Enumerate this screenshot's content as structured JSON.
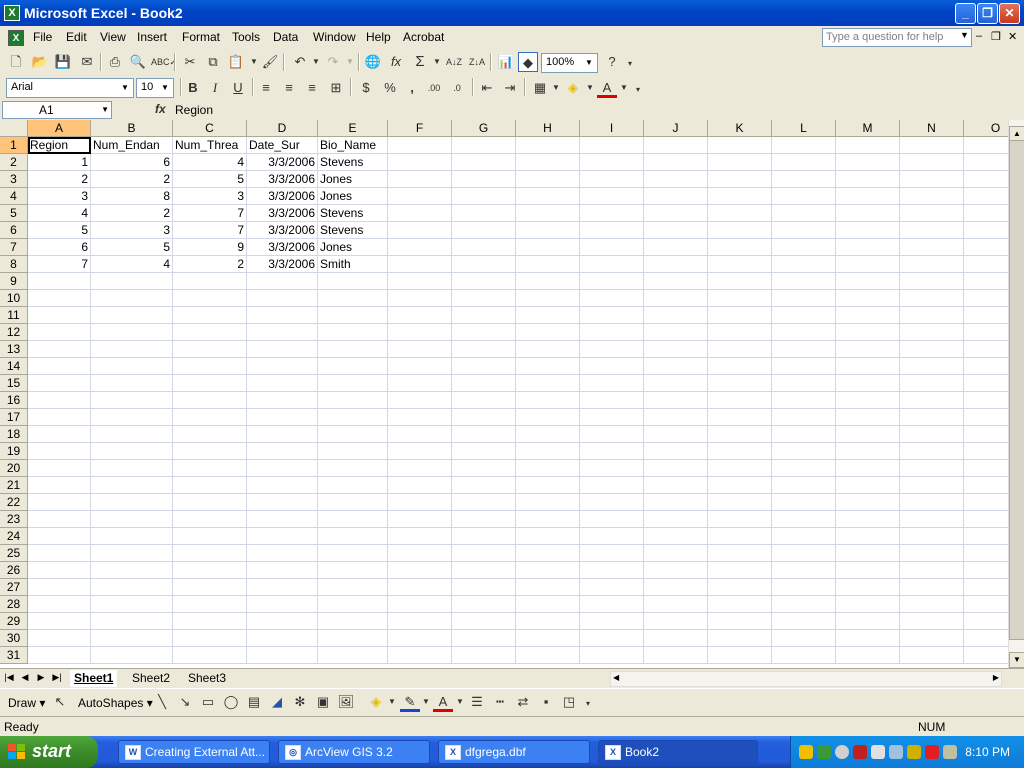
{
  "window": {
    "title": "Microsoft Excel - Book2"
  },
  "menu": [
    "File",
    "Edit",
    "View",
    "Insert",
    "Format",
    "Tools",
    "Data",
    "Window",
    "Help",
    "Acrobat"
  ],
  "help_box_placeholder": "Type a question for help",
  "toolbar": {
    "zoom": "100%",
    "font_name": "Arial",
    "font_size": "10"
  },
  "formula_bar": {
    "name_box": "A1",
    "fx": "fx",
    "value": "Region"
  },
  "columns": [
    "A",
    "B",
    "C",
    "D",
    "E",
    "F",
    "G",
    "H",
    "I",
    "J",
    "K",
    "L",
    "M",
    "N",
    "O"
  ],
  "rows": [
    "1",
    "2",
    "3",
    "4",
    "5",
    "6",
    "7",
    "8",
    "9",
    "10",
    "11",
    "12",
    "13",
    "14",
    "15",
    "16",
    "17",
    "18",
    "19",
    "20",
    "21",
    "22",
    "23",
    "24",
    "25",
    "26",
    "27",
    "28",
    "29",
    "30",
    "31"
  ],
  "table": {
    "headers": [
      "Region",
      "Num_Endan",
      "Num_Threa",
      "Date_Sur",
      "Bio_Name"
    ],
    "rows": [
      [
        "1",
        "6",
        "4",
        "3/3/2006",
        "Stevens"
      ],
      [
        "2",
        "2",
        "5",
        "3/3/2006",
        "Jones"
      ],
      [
        "3",
        "8",
        "3",
        "3/3/2006",
        "Jones"
      ],
      [
        "4",
        "2",
        "7",
        "3/3/2006",
        "Stevens"
      ],
      [
        "5",
        "3",
        "7",
        "3/3/2006",
        "Stevens"
      ],
      [
        "6",
        "5",
        "9",
        "3/3/2006",
        "Jones"
      ],
      [
        "7",
        "4",
        "2",
        "3/3/2006",
        "Smith"
      ]
    ]
  },
  "sheets": [
    "Sheet1",
    "Sheet2",
    "Sheet3"
  ],
  "active_sheet": "Sheet1",
  "drawbar": {
    "draw": "Draw",
    "autoshapes": "AutoShapes"
  },
  "status": {
    "left": "Ready",
    "num": "NUM"
  },
  "taskbar": {
    "start": "start",
    "tasks": [
      "Creating External Att...",
      "ArcView GIS 3.2",
      "dfgrega.dbf",
      "Book2"
    ],
    "clock": "8:10 PM"
  },
  "colors": {
    "titlebar": "#0045c6",
    "taskbar": "#245edc",
    "start": "#3b8c29",
    "selected_header": "#ffc47a"
  }
}
